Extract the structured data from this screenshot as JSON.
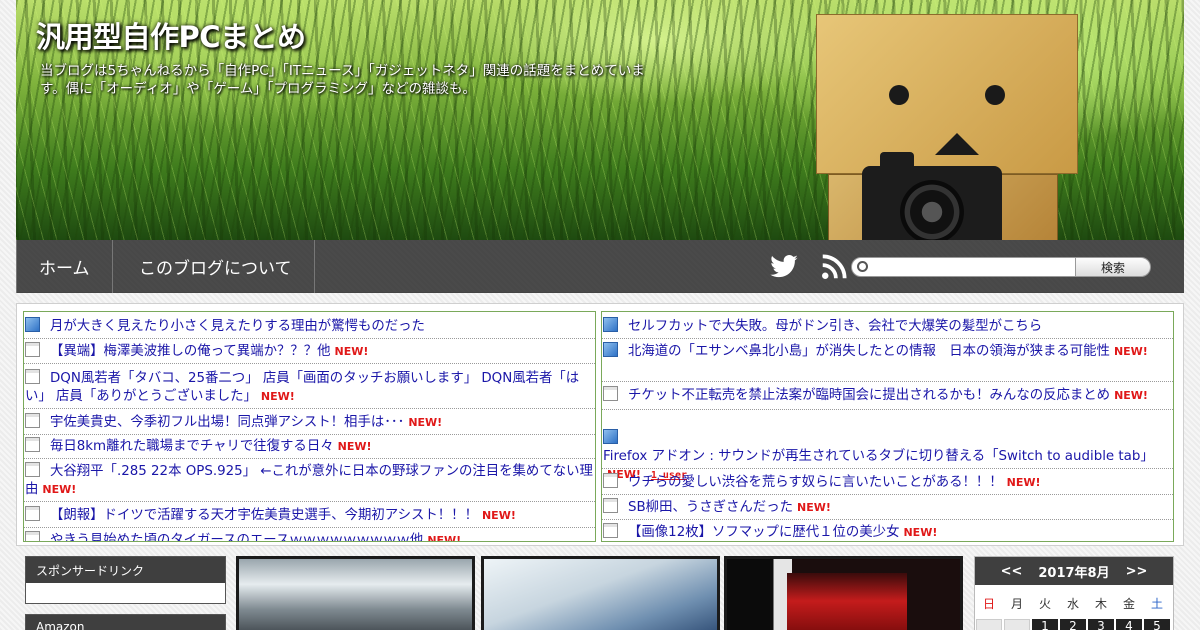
{
  "header": {
    "title": "汎用型自作PCまとめ",
    "description": "当ブログは5ちゃんねるから「自作PC」「ITニュース」「ガジェットネタ」関連の話題をまとめています。偶に「オーディオ」や「ゲーム」「プログラミング」などの雑談も。"
  },
  "nav": {
    "items": [
      "ホーム",
      "このブログについて"
    ],
    "icons": [
      "twitter-icon",
      "rss-icon"
    ]
  },
  "search": {
    "placeholder": "",
    "button_label": "検索"
  },
  "antenna": {
    "left": [
      {
        "icon": "blue",
        "text": "月が大きく見えたり小さく見えたりする理由が驚愕ものだった",
        "new": ""
      },
      {
        "icon": "doc",
        "text": "【異端】梅澤美波推しの俺って異端か？？？他",
        "new": "NEW!"
      },
      {
        "icon": "doc",
        "text": "DQN風若者「タバコ、25番二つ」 店員「画面のタッチお願いします」 DQN風若者「はい」 店員「ありがとうございました」",
        "new": "NEW!"
      },
      {
        "icon": "doc",
        "text": "宇佐美貴史、今季初フル出場！同点弾アシスト！相手は･･･",
        "new": "NEW!"
      },
      {
        "icon": "doc",
        "text": "毎日8km離れた職場までチャリで往復する日々",
        "new": "NEW!"
      },
      {
        "icon": "doc",
        "text": "大谷翔平「.285 22本 OPS.925」 ←これが意外に日本の野球ファンの注目を集めてない理由",
        "new": "NEW!"
      },
      {
        "icon": "doc",
        "text": "【朗報】ドイツで活躍する天才宇佐美貴史選手、今期初アシスト！！！",
        "new": "NEW!"
      },
      {
        "icon": "doc",
        "text": "やきう見始めた頃のタイガースのエースｗｗｗｗｗｗｗｗｗ他",
        "new": "NEW!"
      }
    ],
    "right": [
      {
        "icon": "blue",
        "text": "セルフカットで大失敗。母がドン引き、会社で大爆笑の髪型がこちら",
        "new": "",
        "users": ""
      },
      {
        "icon": "blue",
        "text": "北海道の「エサンベ鼻北小島」が消失したとの情報　日本の領海が狭まる可能性",
        "new": "NEW!",
        "users": ""
      },
      {
        "icon": "doc",
        "text": "チケット不正転売を禁止法案が臨時国会に提出されるかも！みんなの反応まとめ",
        "new": "NEW!",
        "users": ""
      },
      {
        "icon": "blue",
        "text": "Firefox アドオン : サウンドが再生されているタブに切り替える「Switch to audible tab」",
        "new": "NEW!",
        "users": "1 user"
      },
      {
        "icon": "doc",
        "text": "ウチらの愛しい渋谷を荒らす奴らに言いたいことがある！！！",
        "new": "NEW!",
        "users": ""
      },
      {
        "icon": "doc",
        "text": "SB柳田、うさぎさんだった",
        "new": "NEW!",
        "users": ""
      },
      {
        "icon": "doc",
        "text": "【画像12枚】ソフマップに歴代１位の美少女",
        "new": "NEW!",
        "users": ""
      }
    ]
  },
  "sidebar": {
    "sponsor_title": "スポンサードリンク",
    "amazon_title": "Amazon"
  },
  "calendar": {
    "prev": "<<",
    "next": ">>",
    "month_label": "2017年8月",
    "weekdays": [
      "日",
      "月",
      "火",
      "水",
      "木",
      "金",
      "土"
    ],
    "first_row": [
      "",
      "",
      "1",
      "2",
      "3",
      "4",
      "5"
    ]
  },
  "colors": {
    "link": "#1a16a8",
    "new_badge": "#e01818",
    "antenna_border": "#7aa95a",
    "nav_bg": "#191919"
  }
}
